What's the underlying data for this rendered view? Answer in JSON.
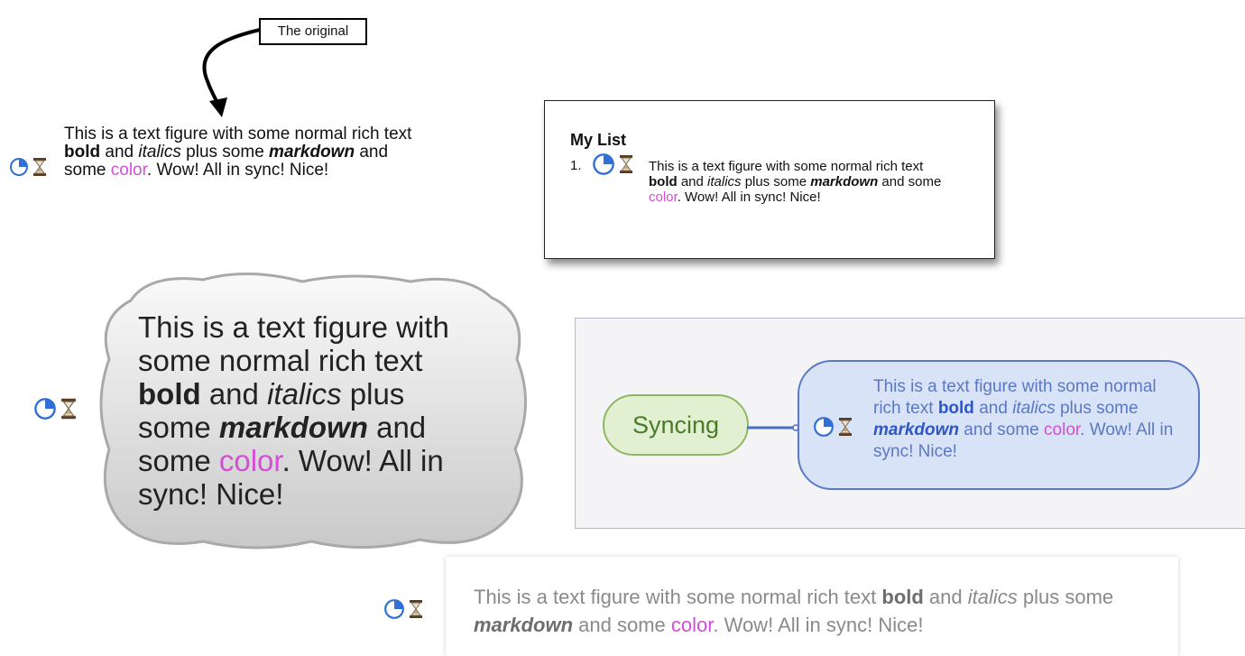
{
  "callout": {
    "label": "The original"
  },
  "figure": {
    "t1": "This is a text figure with some normal rich text ",
    "bold": "bold",
    "t2": " and ",
    "italics": "italics",
    "t3": " plus some ",
    "markdown": "markdown",
    "t4": " and some ",
    "color_word": "color",
    "t5": ". Wow! All in sync! Nice!"
  },
  "list": {
    "title": "My List",
    "number": "1."
  },
  "mindmap": {
    "node_label": "Syncing"
  },
  "icons": {
    "status": "pie-progress-icon",
    "timer": "hourglass-icon"
  },
  "colors": {
    "accent_pink": "#d24fd6",
    "pie_blue": "#2f6fd6",
    "mind_green": "#8fb864",
    "mind_blue": "#5b79c7"
  }
}
